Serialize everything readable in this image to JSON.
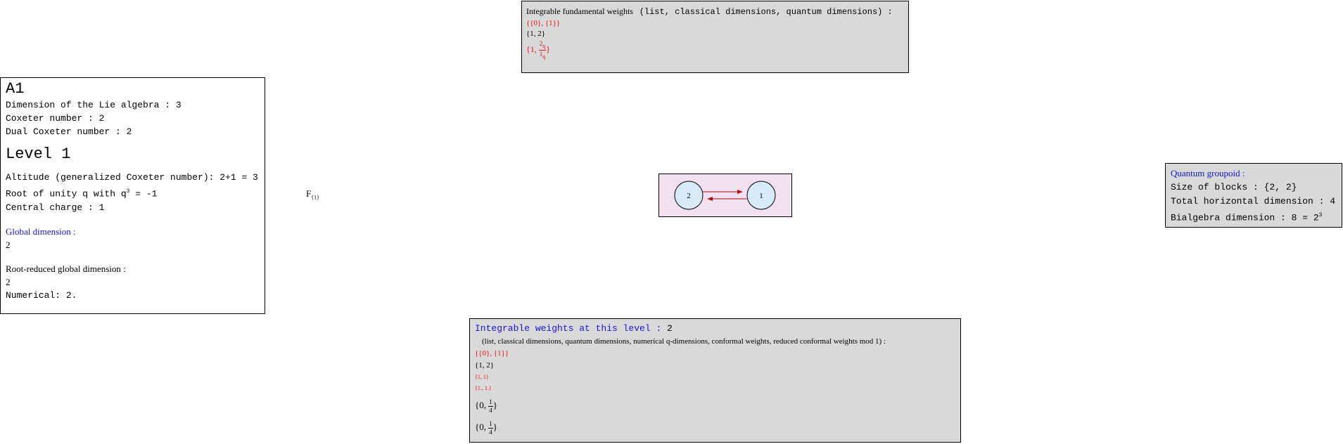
{
  "fundamental": {
    "header_serif": "Integrable fundamental weights",
    "header_mono": "(list, classical dimensions, quantum dimensions) :",
    "list": "{{0}, {1}}",
    "classical": "{1, 2}",
    "quantum_open": "{1, ",
    "quantum_num": "2",
    "quantum_num_sub": "q",
    "quantum_den": "1",
    "quantum_den_sub": "q",
    "quantum_close": "}"
  },
  "info": {
    "title": "A1",
    "dim_lie": "Dimension of the Lie algebra : 3",
    "coxeter": "Coxeter number : 2",
    "dual_coxeter": "Dual Coxeter number : 2",
    "level": "Level 1",
    "altitude": "Altitude (generalized Coxeter number): 2+1 = 3",
    "root_unity_pre": "Root of unity q with q",
    "root_unity_exp": "3",
    "root_unity_post": " = -1",
    "central_charge": "Central charge : 1",
    "global_dim_label": "Global dimension :",
    "global_dim_value": "2",
    "root_reduced_label": "Root-reduced global dimension :",
    "root_reduced_value": "2",
    "numerical": "Numerical: 2."
  },
  "f_label": {
    "main": "F",
    "sub": "{1}"
  },
  "graph": {
    "nodes": [
      "2",
      "1"
    ],
    "fill": "#d6eaf8",
    "background": "#f2e1f0",
    "edge_color": "#b01010"
  },
  "groupoid": {
    "title": "Quantum groupoid :",
    "blocks": "Size of blocks : {2, 2}",
    "total_h": "Total horizontal dimension : 4",
    "bialg_pre": "Bialgebra dimension : 8 = 2",
    "bialg_exp": "3"
  },
  "weights": {
    "title": "Integrable weights at this level : ",
    "title_value": "2",
    "subtitle": "(list, classical dimensions, quantum dimensions, numerical q-dimensions, conformal weights, reduced conformal weights mod 1) :",
    "list": "{{0}, {1}}",
    "classical": "{1, 2}",
    "quantum": "{1, 1}",
    "numerical": "{1., 1.}",
    "conformal_open": "{0, ",
    "conformal_num": "1",
    "conformal_den": "4",
    "conformal_close": "}",
    "reduced_open": "{0, ",
    "reduced_num": "1",
    "reduced_den": "4",
    "reduced_close": "}"
  }
}
